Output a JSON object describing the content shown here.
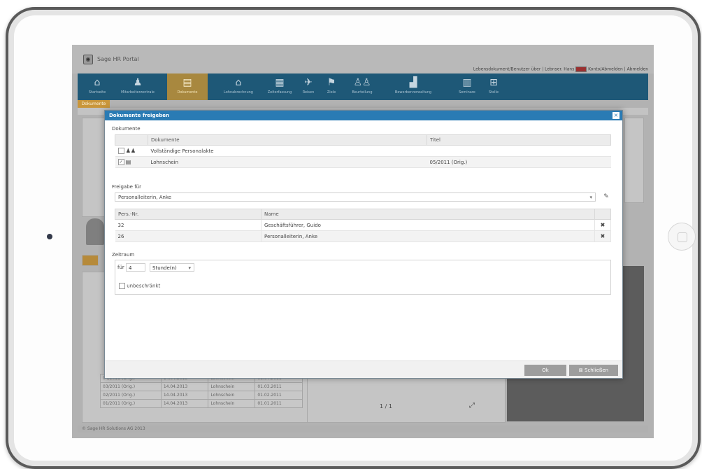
{
  "app": {
    "title": "Sage HR Portal",
    "top_links": "Lebensdokument/Benutzer über | Lebnser. Hans",
    "top_links2": "Konto/Abmelden | Abmelden"
  },
  "nav": {
    "items": [
      {
        "label": "Startseite",
        "icon": "home-icon"
      },
      {
        "label": "Mitarbeiterzentrale",
        "icon": "org-chart-icon"
      },
      {
        "label": "Dokumente",
        "icon": "document-icon",
        "active": true
      },
      {
        "label": "Lohnabrechnung",
        "icon": "building-icon"
      },
      {
        "label": "Zeiterfassung",
        "icon": "calendar-icon"
      },
      {
        "label": "Reisen",
        "icon": "plane-icon"
      },
      {
        "label": "Ziele",
        "icon": "flag-icon"
      },
      {
        "label": "Beurteilung",
        "icon": "people-icon"
      },
      {
        "label": "Bewerberverwaltung",
        "icon": "chart-icon"
      },
      {
        "label": "Seminare",
        "icon": "books-icon"
      },
      {
        "label": "Stelle",
        "icon": "hierarchy-icon"
      }
    ]
  },
  "subtab": "Dokumente",
  "modal": {
    "title": "Dokumente freigeben",
    "close": "×",
    "dokumente_label": "Dokumente",
    "columns": [
      "Dokumente",
      "Titel"
    ],
    "rows": [
      {
        "checked": false,
        "icon": "people-icon",
        "name": "Vollständige Personalakte",
        "titel": ""
      },
      {
        "checked": true,
        "icon": "document-icon",
        "name": "Lohnschein",
        "titel": "05/2011 (Orig.)"
      }
    ],
    "freigabe_label": "Freigabe für",
    "freigabe_value": "Personalleiterin, Anke",
    "person_columns": [
      "Pers.-Nr.",
      "Name"
    ],
    "persons": [
      {
        "nr": "32",
        "name": "Geschäftsführer, Guido"
      },
      {
        "nr": "26",
        "name": "Personalleiterin, Anke"
      }
    ],
    "zeitraum_label": "Zeitraum",
    "fuer_label": "für",
    "amount": "4",
    "unit": "Stunde(n)",
    "unlimited_label": "unbeschränkt",
    "ok_label": "Ok",
    "close_label": "Schließen"
  },
  "background": {
    "rows": [
      [
        "04/2011 (Orig.)",
        "14.04.2013",
        "Lohnschein",
        "01.04.2011"
      ],
      [
        "03/2011 (Orig.)",
        "14.04.2013",
        "Lohnschein",
        "01.03.2011"
      ],
      [
        "02/2011 (Orig.)",
        "14.04.2013",
        "Lohnschein",
        "01.02.2011"
      ],
      [
        "01/2011 (Orig.)",
        "14.04.2013",
        "Lohnschein",
        "01.01.2011"
      ]
    ],
    "pager": "1 / 1",
    "footer": "© Sage HR Solutions AG 2013"
  }
}
